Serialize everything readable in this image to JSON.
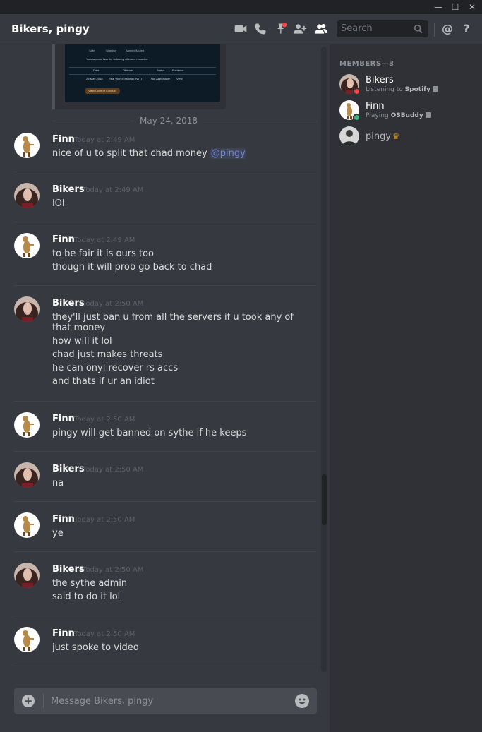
{
  "window": {
    "minimize_glyph": "—",
    "maximize_glyph": "☐",
    "close_glyph": "✕"
  },
  "header": {
    "title": "Bikers, pingy",
    "icons": [
      "video-icon",
      "phone-icon",
      "pin-icon",
      "add-member-icon",
      "members-icon",
      "mention-icon",
      "help-icon"
    ],
    "search_placeholder": "Search",
    "mention_glyph": "@",
    "help_glyph": "?"
  },
  "chat": {
    "date_divider": "May 24, 2018",
    "embed": {
      "legend": [
        "Safe",
        "Warning",
        "Banned/Muted"
      ],
      "summary": "Your account has the following offences recorded:",
      "columns": [
        "Date",
        "Offence",
        "Status",
        "Evidence"
      ],
      "row": [
        "29-May-2018",
        "Real World Trading (RWT)",
        "Not Appealable",
        "View"
      ],
      "button": "View Code of Conduct"
    },
    "messages": [
      {
        "author": "Finn",
        "time": "Today at 2:49 AM",
        "lines": [
          "nice of u to split that chad money "
        ],
        "mention": "@pingy"
      },
      {
        "author": "Bikers",
        "time": "Today at 2:49 AM",
        "lines": [
          "lOl"
        ]
      },
      {
        "author": "Finn",
        "time": "Today at 2:49 AM",
        "lines": [
          "to be fair it is ours too",
          "though it will prob go back to chad"
        ]
      },
      {
        "author": "Bikers",
        "time": "Today at 2:50 AM",
        "lines": [
          "they'll just ban u from all the servers if u took any of that money",
          "how will it lol",
          "chad just makes threats",
          "he can onyl recover rs accs",
          "and thats if ur an idiot"
        ]
      },
      {
        "author": "Finn",
        "time": "Today at 2:50 AM",
        "lines": [
          "pingy will get banned on sythe if he keeps"
        ]
      },
      {
        "author": "Bikers",
        "time": "Today at 2:50 AM",
        "lines": [
          "na"
        ]
      },
      {
        "author": "Finn",
        "time": "Today at 2:50 AM",
        "lines": [
          "ye"
        ]
      },
      {
        "author": "Bikers",
        "time": "Today at 2:50 AM",
        "lines": [
          "the sythe admin",
          "said to do it lol"
        ]
      },
      {
        "author": "Finn",
        "time": "Today at 2:50 AM",
        "lines": [
          "just spoke to video"
        ]
      }
    ],
    "composer_placeholder": "Message Bikers, pingy",
    "add_glyph": "+"
  },
  "members": {
    "header": "MEMBERS—3",
    "list": [
      {
        "name": "Bikers",
        "status_prefix": "Listening to ",
        "status_bold": "Spotify",
        "presence": "dnd",
        "presence_color": "#f04747"
      },
      {
        "name": "Finn",
        "status_prefix": "Playing ",
        "status_bold": "OSBuddy",
        "presence": "online",
        "presence_color": "#43b581"
      },
      {
        "name": "pingy",
        "owner_glyph": "♛"
      }
    ]
  },
  "colors": {
    "background": "#36393f",
    "sidebar": "#2f3136",
    "accent_mention": "#7289da",
    "dnd": "#f04747",
    "online": "#43b581",
    "crown": "#faa61a"
  }
}
